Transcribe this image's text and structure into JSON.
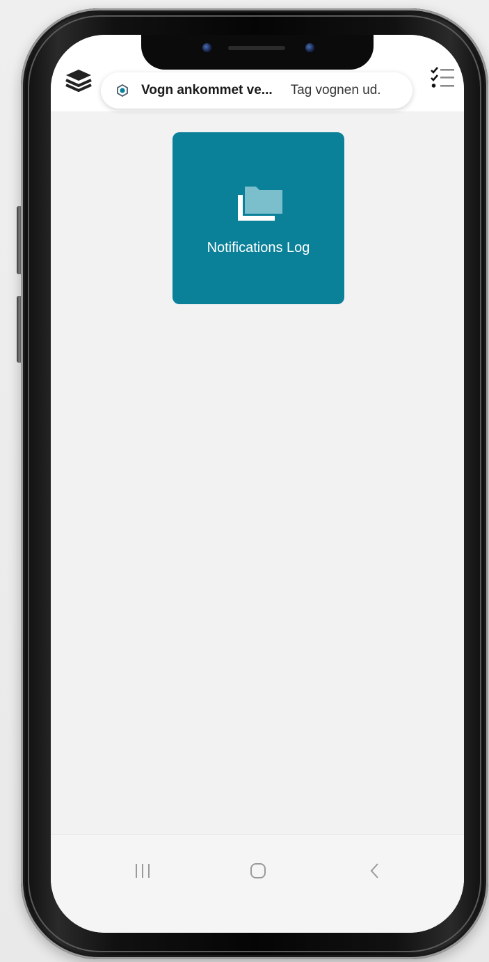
{
  "header": {
    "notification": {
      "title": "Vogn ankommet ve...",
      "message": "Tag vognen ud."
    }
  },
  "main": {
    "tiles": [
      {
        "label": "Notifications Log",
        "icon": "folder-icon",
        "color": "#0a8099"
      }
    ]
  },
  "icons": {
    "menu": "layers-icon",
    "tasks": "checklist-icon",
    "app": "app-badge-icon"
  },
  "navigation": {
    "buttons": [
      "recents",
      "home",
      "back"
    ]
  },
  "colors": {
    "accent": "#0a8099",
    "background": "#f2f2f2",
    "header": "#ffffff"
  }
}
